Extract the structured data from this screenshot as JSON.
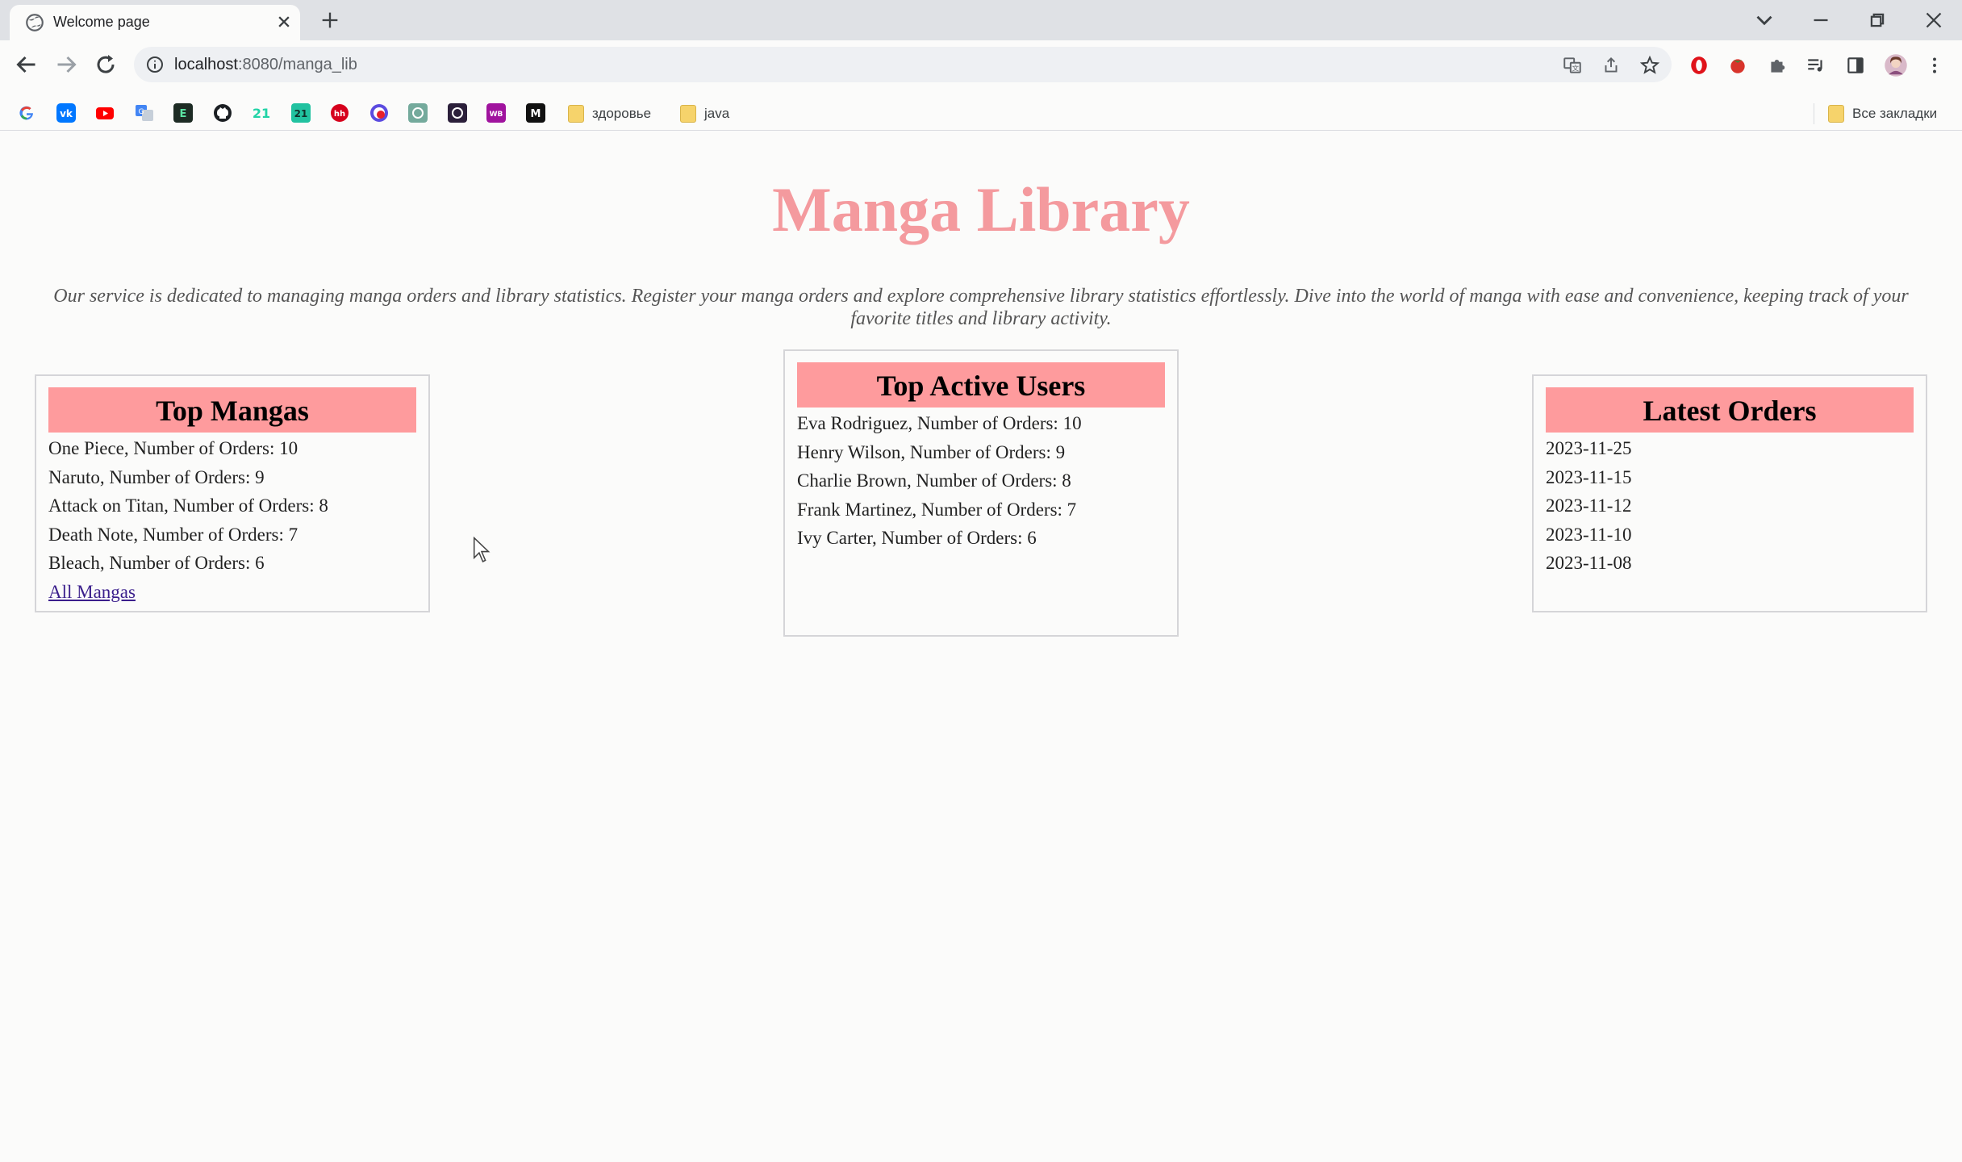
{
  "browser": {
    "tab_title": "Welcome page",
    "url_host": "localhost",
    "url_path": ":8080/manga_lib",
    "bookmark_folders": [
      "здоровье",
      "java"
    ],
    "all_bookmarks": "Все закладки",
    "bookmark_icons": [
      "google-icon",
      "vk-icon",
      "youtube-icon",
      "translate-icon",
      "dash-icon",
      "github-icon",
      "zi-icon",
      "zi-square-icon",
      "hh-icon",
      "music-icon",
      "openai-icon",
      "dark-app-icon",
      "wb-icon",
      "m-icon"
    ],
    "accent": "#fe9b9d"
  },
  "page": {
    "title": "Manga Library",
    "intro": "Our service is dedicated to managing manga orders and library statistics. Register your manga orders and explore comprehensive library statistics effortlessly. Dive into the world of manga with ease and convenience, keeping track of your favorite titles and library activity."
  },
  "top_mangas": {
    "heading": "Top Mangas",
    "items": [
      "One Piece, Number of Orders: 10",
      "Naruto, Number of Orders: 9",
      "Attack on Titan, Number of Orders: 8",
      "Death Note, Number of Orders: 7",
      "Bleach, Number of Orders: 6"
    ],
    "link": "All Mangas"
  },
  "top_users": {
    "heading": "Top Active Users",
    "items": [
      "Eva Rodriguez, Number of Orders: 10",
      "Henry Wilson, Number of Orders: 9",
      "Charlie Brown, Number of Orders: 8",
      "Frank Martinez, Number of Orders: 7",
      "Ivy Carter, Number of Orders: 6"
    ]
  },
  "latest_orders": {
    "heading": "Latest Orders",
    "items": [
      "2023-11-25",
      "2023-11-15",
      "2023-11-12",
      "2023-11-10",
      "2023-11-08"
    ]
  }
}
